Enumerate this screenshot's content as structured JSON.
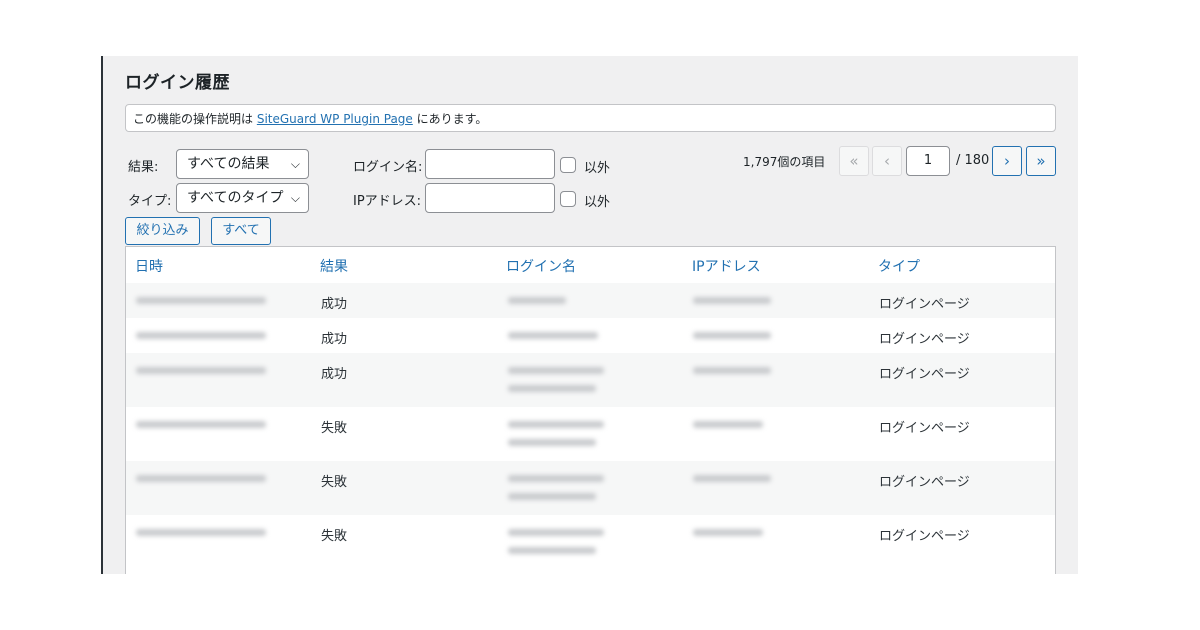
{
  "page": {
    "title": "ログイン履歴",
    "notice_prefix": "この機能の操作説明は ",
    "notice_link": "SiteGuard WP Plugin Page",
    "notice_suffix": " にあります。"
  },
  "filters": {
    "result_label": "結果:",
    "result_value": "すべての結果",
    "type_label": "タイプ:",
    "type_value": "すべてのタイプ",
    "login_label": "ログイン名:",
    "login_value": "",
    "ip_label": "IPアドレス:",
    "ip_value": "",
    "except_label": "以外",
    "filter_button": "絞り込み",
    "all_button": "すべて"
  },
  "pagination": {
    "count": "1,797個の項目",
    "first": "«",
    "prev": "‹",
    "current": "1",
    "total": "/ 180",
    "next": "›",
    "last": "»"
  },
  "table": {
    "columns": [
      "日時",
      "結果",
      "ログイン名",
      "IPアドレス",
      "タイプ"
    ],
    "rows": [
      {
        "result": "成功",
        "type": "ログインページ"
      },
      {
        "result": "成功",
        "type": "ログインページ"
      },
      {
        "result": "成功",
        "type": "ログインページ"
      },
      {
        "result": "失敗",
        "type": "ログインページ"
      },
      {
        "result": "失敗",
        "type": "ログインページ"
      },
      {
        "result": "失敗",
        "type": "ログインページ"
      }
    ]
  },
  "icons": {
    "chevron": "chevron-down-icon"
  }
}
